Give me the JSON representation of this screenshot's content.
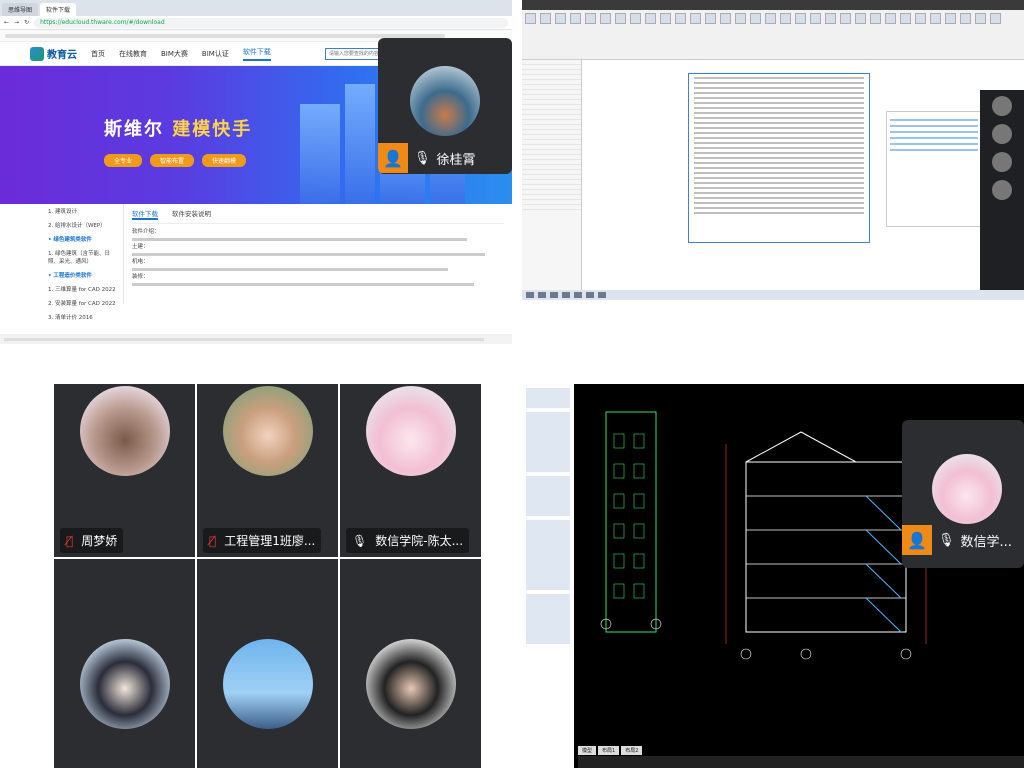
{
  "browser": {
    "tabs": [
      "思维导图",
      "软件下载"
    ],
    "url": "https://educloud.thware.com/#/download",
    "site_logo": "教育云",
    "nav": [
      "首页",
      "在线教育",
      "BIM大赛",
      "BIM认证",
      "软件下载"
    ],
    "search_placeholder": "请输入您要查找的内容",
    "banner_title_main": "斯维尔",
    "banner_title_accent": "建模快手",
    "banner_buttons": [
      "全专业",
      "智能布置",
      "快速翻模"
    ],
    "sidebar_items": [
      "1. 建筑设计",
      "2. 给排水设计（WEP）",
      "• 绿色建筑类软件",
      "1. 绿色建筑（含节能、日照、采光、通风）",
      "• 工程造价类软件",
      "1. 三维算量 for CAD 2022",
      "2. 安装算量 for CAD 2022",
      "3. 清单计价 2016"
    ],
    "content_tabs": [
      "软件下载",
      "软件安装说明"
    ],
    "content_heading": "软件介绍：",
    "content_lines": [
      "土建：",
      "机电：",
      "装修："
    ]
  },
  "float_top": {
    "name": "徐桂霄"
  },
  "float_bottom": {
    "name": "数信学..."
  },
  "gallery": [
    {
      "name": "周梦娇",
      "muted": true
    },
    {
      "name": "工程管理1班廖...",
      "muted": true
    },
    {
      "name": "数信学院-陈太...",
      "muted": false
    },
    {
      "name": "",
      "muted": false
    },
    {
      "name": "",
      "muted": false
    },
    {
      "name": "",
      "muted": false
    }
  ],
  "cad": {
    "tabs": [
      "模型",
      "布局1",
      "布局2"
    ]
  },
  "colors": {
    "orange": "#f08a16",
    "accent": "#1a74d1",
    "tile": "#2b2d31"
  }
}
